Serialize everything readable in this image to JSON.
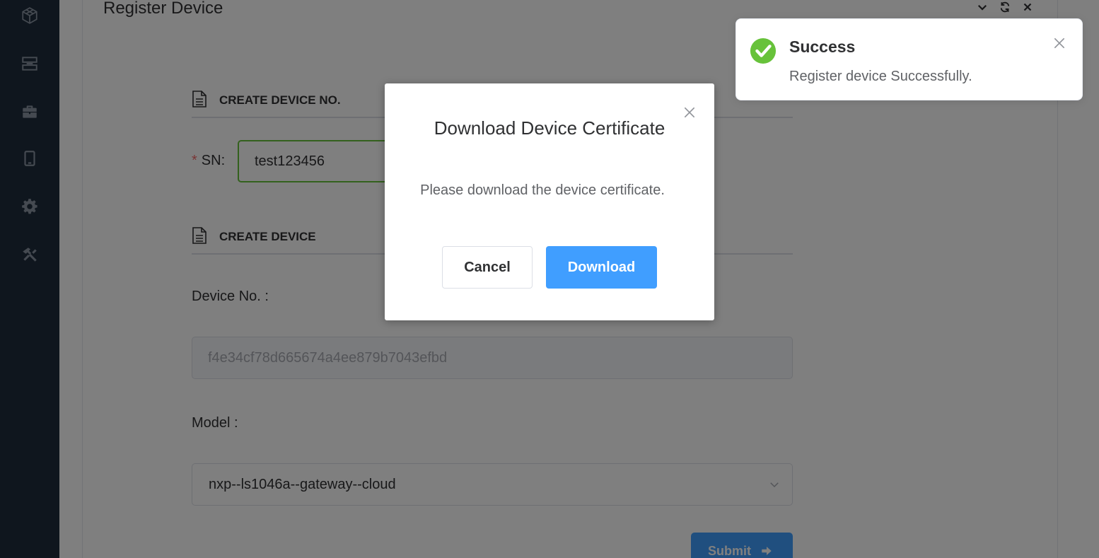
{
  "sidebar": {
    "icons": [
      "cube-icon",
      "server-icon",
      "briefcase-icon",
      "tablet-icon",
      "gear-icon",
      "tools-icon"
    ]
  },
  "panel": {
    "title": "Register Device"
  },
  "section_create_no": {
    "heading": "CREATE DEVICE NO."
  },
  "sn": {
    "required_mark": "*",
    "label": "SN:",
    "value": "test123456"
  },
  "section_create": {
    "heading": "CREATE DEVICE"
  },
  "device_no": {
    "label": "Device No. :",
    "value": "f4e34cf78d665674a4ee879b7043efbd"
  },
  "model": {
    "label": "Model :",
    "value": "nxp--ls1046a--gateway--cloud"
  },
  "submit": {
    "label": "Submit"
  },
  "dialog": {
    "title": "Download Device Certificate",
    "body": "Please download the device certificate.",
    "cancel_label": "Cancel",
    "download_label": "Download"
  },
  "toast": {
    "title": "Success",
    "message": "Register device Successfully.",
    "accent": "#67c23a"
  },
  "colors": {
    "primary": "#409eff",
    "success": "#67c23a",
    "sidebar": "#1f2d3d",
    "required": "#f56c6c"
  }
}
